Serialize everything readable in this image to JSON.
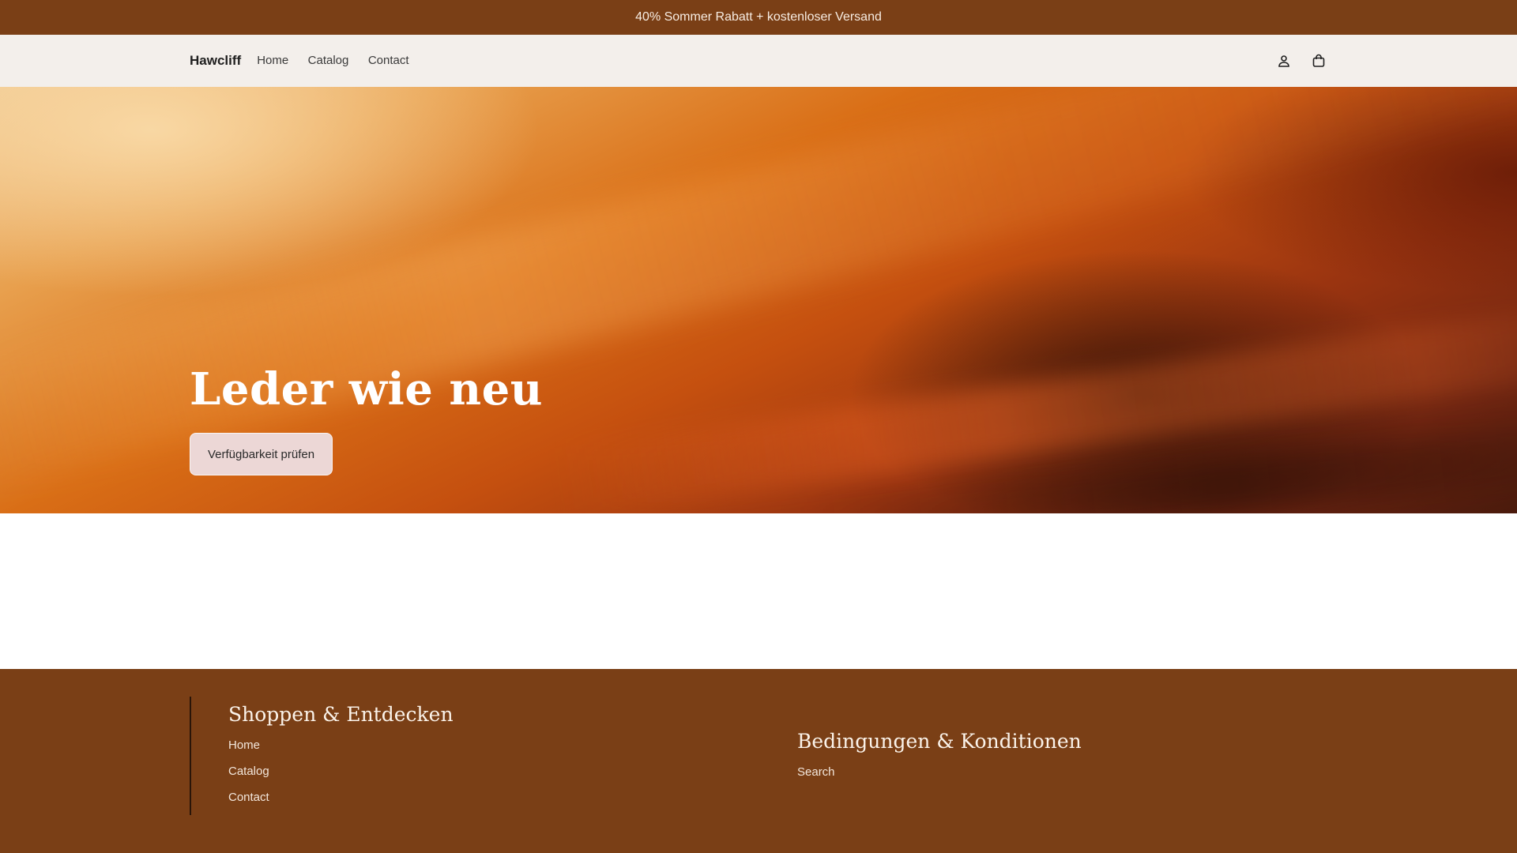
{
  "announcement": {
    "text": "40% Sommer Rabatt + kostenloser Versand"
  },
  "header": {
    "brand": "Hawcliff",
    "nav": [
      "Home",
      "Catalog",
      "Contact"
    ],
    "icons": [
      "account-icon",
      "cart-bag-icon"
    ]
  },
  "hero": {
    "title": "Leder wie neu",
    "cta": "Verfügbarkeit prüfen"
  },
  "footer": {
    "col1": {
      "heading": "Shoppen & Entdecken",
      "links": [
        "Home",
        "Catalog",
        "Contact"
      ]
    },
    "col2": {
      "heading": "Bedingungen & Konditionen",
      "links": [
        "Search"
      ]
    }
  },
  "colors": {
    "brand_brown": "#7a3f16",
    "header_bg": "#f3efeb",
    "cta_bg": "#ecd7d6"
  }
}
